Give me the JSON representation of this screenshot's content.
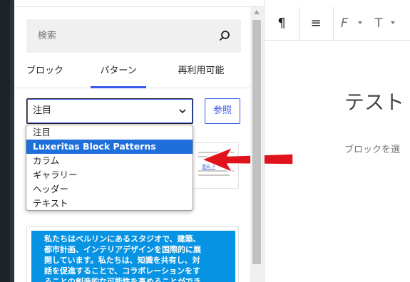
{
  "search": {
    "placeholder": "検索"
  },
  "tabs": [
    {
      "label": "ブロック"
    },
    {
      "label": "パターン"
    },
    {
      "label": "再利用可能"
    }
  ],
  "category_select": {
    "value": "注目",
    "options": [
      "注目",
      "Luxeritas Block Patterns",
      "カラム",
      "ギャラリー",
      "ヘッダー",
      "テキスト"
    ],
    "highlighted_option": "Luxeritas Block Patterns"
  },
  "browse_button": {
    "label": "参照"
  },
  "preview_card_2": {
    "lines": [
      "私たちはベルリンにあるスタジオで、建築、",
      "都市計画、インテリアデザインを国際的に展",
      "開しています。私たちは、知識を共有し、対",
      "話を促進することで、コラボレーションをす",
      "ることの創造的な可能性を高めることができ"
    ]
  },
  "preview_card_1": {
    "link_text": "過去 ↗"
  },
  "editor": {
    "title": "テスト",
    "placeholder": "ブロックを選"
  },
  "toolbar": {
    "paragraph_icon": "¶",
    "align_icon": "≡",
    "font_icon": "F",
    "text_size_icon": "T"
  },
  "colors": {
    "accent": "#3858e9",
    "selected_option": "#1e6fd9",
    "annotation_arrow": "#e0121b",
    "card_blue": "#0693e3"
  }
}
